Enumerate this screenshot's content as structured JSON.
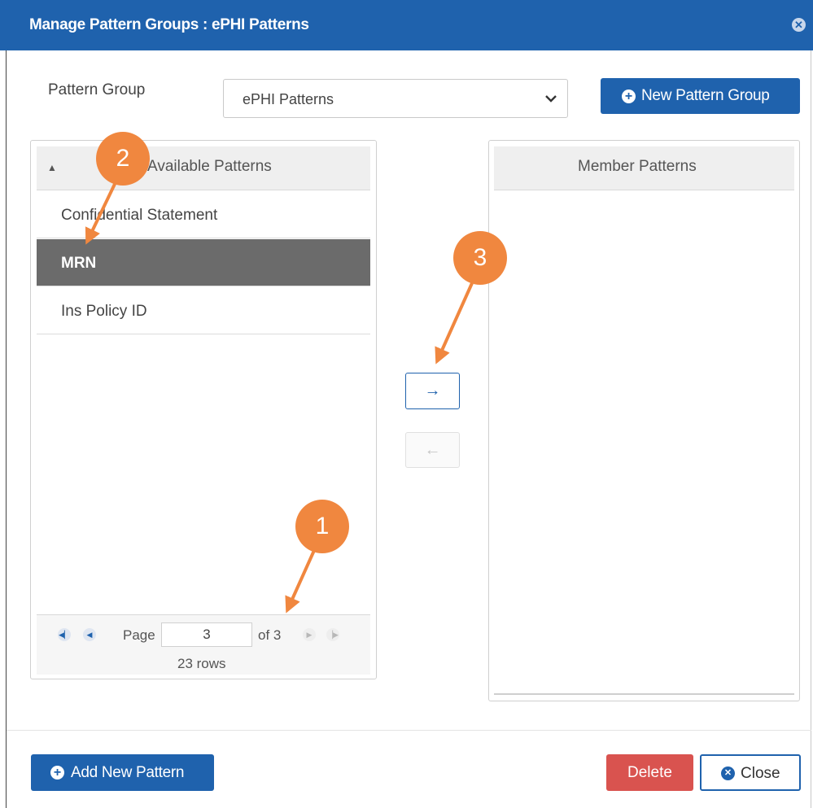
{
  "dialog": {
    "title": "Manage Pattern Groups : ePHI Patterns",
    "close_icon": "close-circle-icon"
  },
  "pattern_group": {
    "label": "Pattern Group",
    "selected": "ePHI Patterns",
    "new_button": "New Pattern Group"
  },
  "available": {
    "header": "Available Patterns",
    "items": [
      {
        "label": "Confidential Statement",
        "selected": false
      },
      {
        "label": "MRN",
        "selected": true
      },
      {
        "label": "Ins Policy ID",
        "selected": false
      }
    ],
    "pager": {
      "page_label": "Page",
      "page": "3",
      "of_label": "of 3",
      "rows_label": "23 rows"
    }
  },
  "transfer": {
    "right": "→",
    "left": "←"
  },
  "member": {
    "header": "Member Patterns",
    "items": []
  },
  "footer": {
    "add_new": "Add New Pattern",
    "delete": "Delete",
    "close": "Close"
  },
  "callouts": [
    "1",
    "2",
    "3"
  ],
  "colors": {
    "primary": "#1f62ad",
    "danger": "#d9534f",
    "callout": "#f0873f",
    "selected_row": "#6b6b6b"
  }
}
